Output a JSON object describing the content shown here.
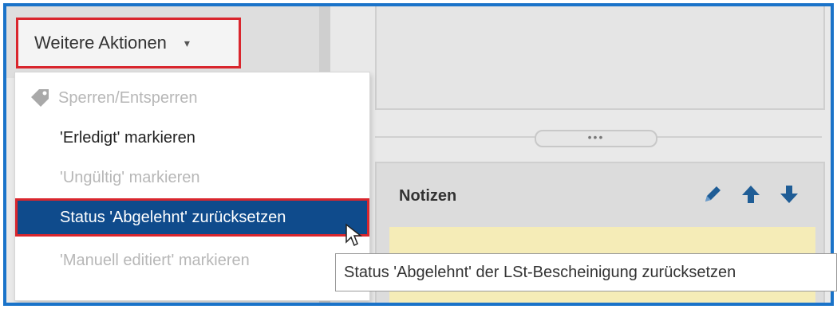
{
  "toolbar": {
    "actions_label": "Weitere Aktionen",
    "caret": "▾"
  },
  "menu": {
    "items": [
      {
        "label": "Sperren/Entsperren",
        "state": "disabled",
        "icon": "tag-icon"
      },
      {
        "label": "'Erledigt' markieren",
        "state": "enabled"
      },
      {
        "label": "'Ungültig' markieren",
        "state": "disabled"
      },
      {
        "label": "Status 'Abgelehnt' zurücksetzen",
        "state": "selected"
      },
      {
        "label": "'Manuell editiert' markieren",
        "state": "disabled"
      }
    ]
  },
  "panel": {
    "splitter_label": "•••",
    "notes_title": "Notizen",
    "icons": [
      "pencil-icon",
      "arrow-up-icon",
      "arrow-down-icon"
    ]
  },
  "tooltip": {
    "text": "Status 'Abgelehnt' der LSt-Bescheinigung zurücksetzen"
  },
  "colors": {
    "accent": "#1a73c9",
    "highlight": "#d9262d",
    "selected_bg": "#0f4b8c",
    "notes_bg": "#f5ecb7"
  }
}
